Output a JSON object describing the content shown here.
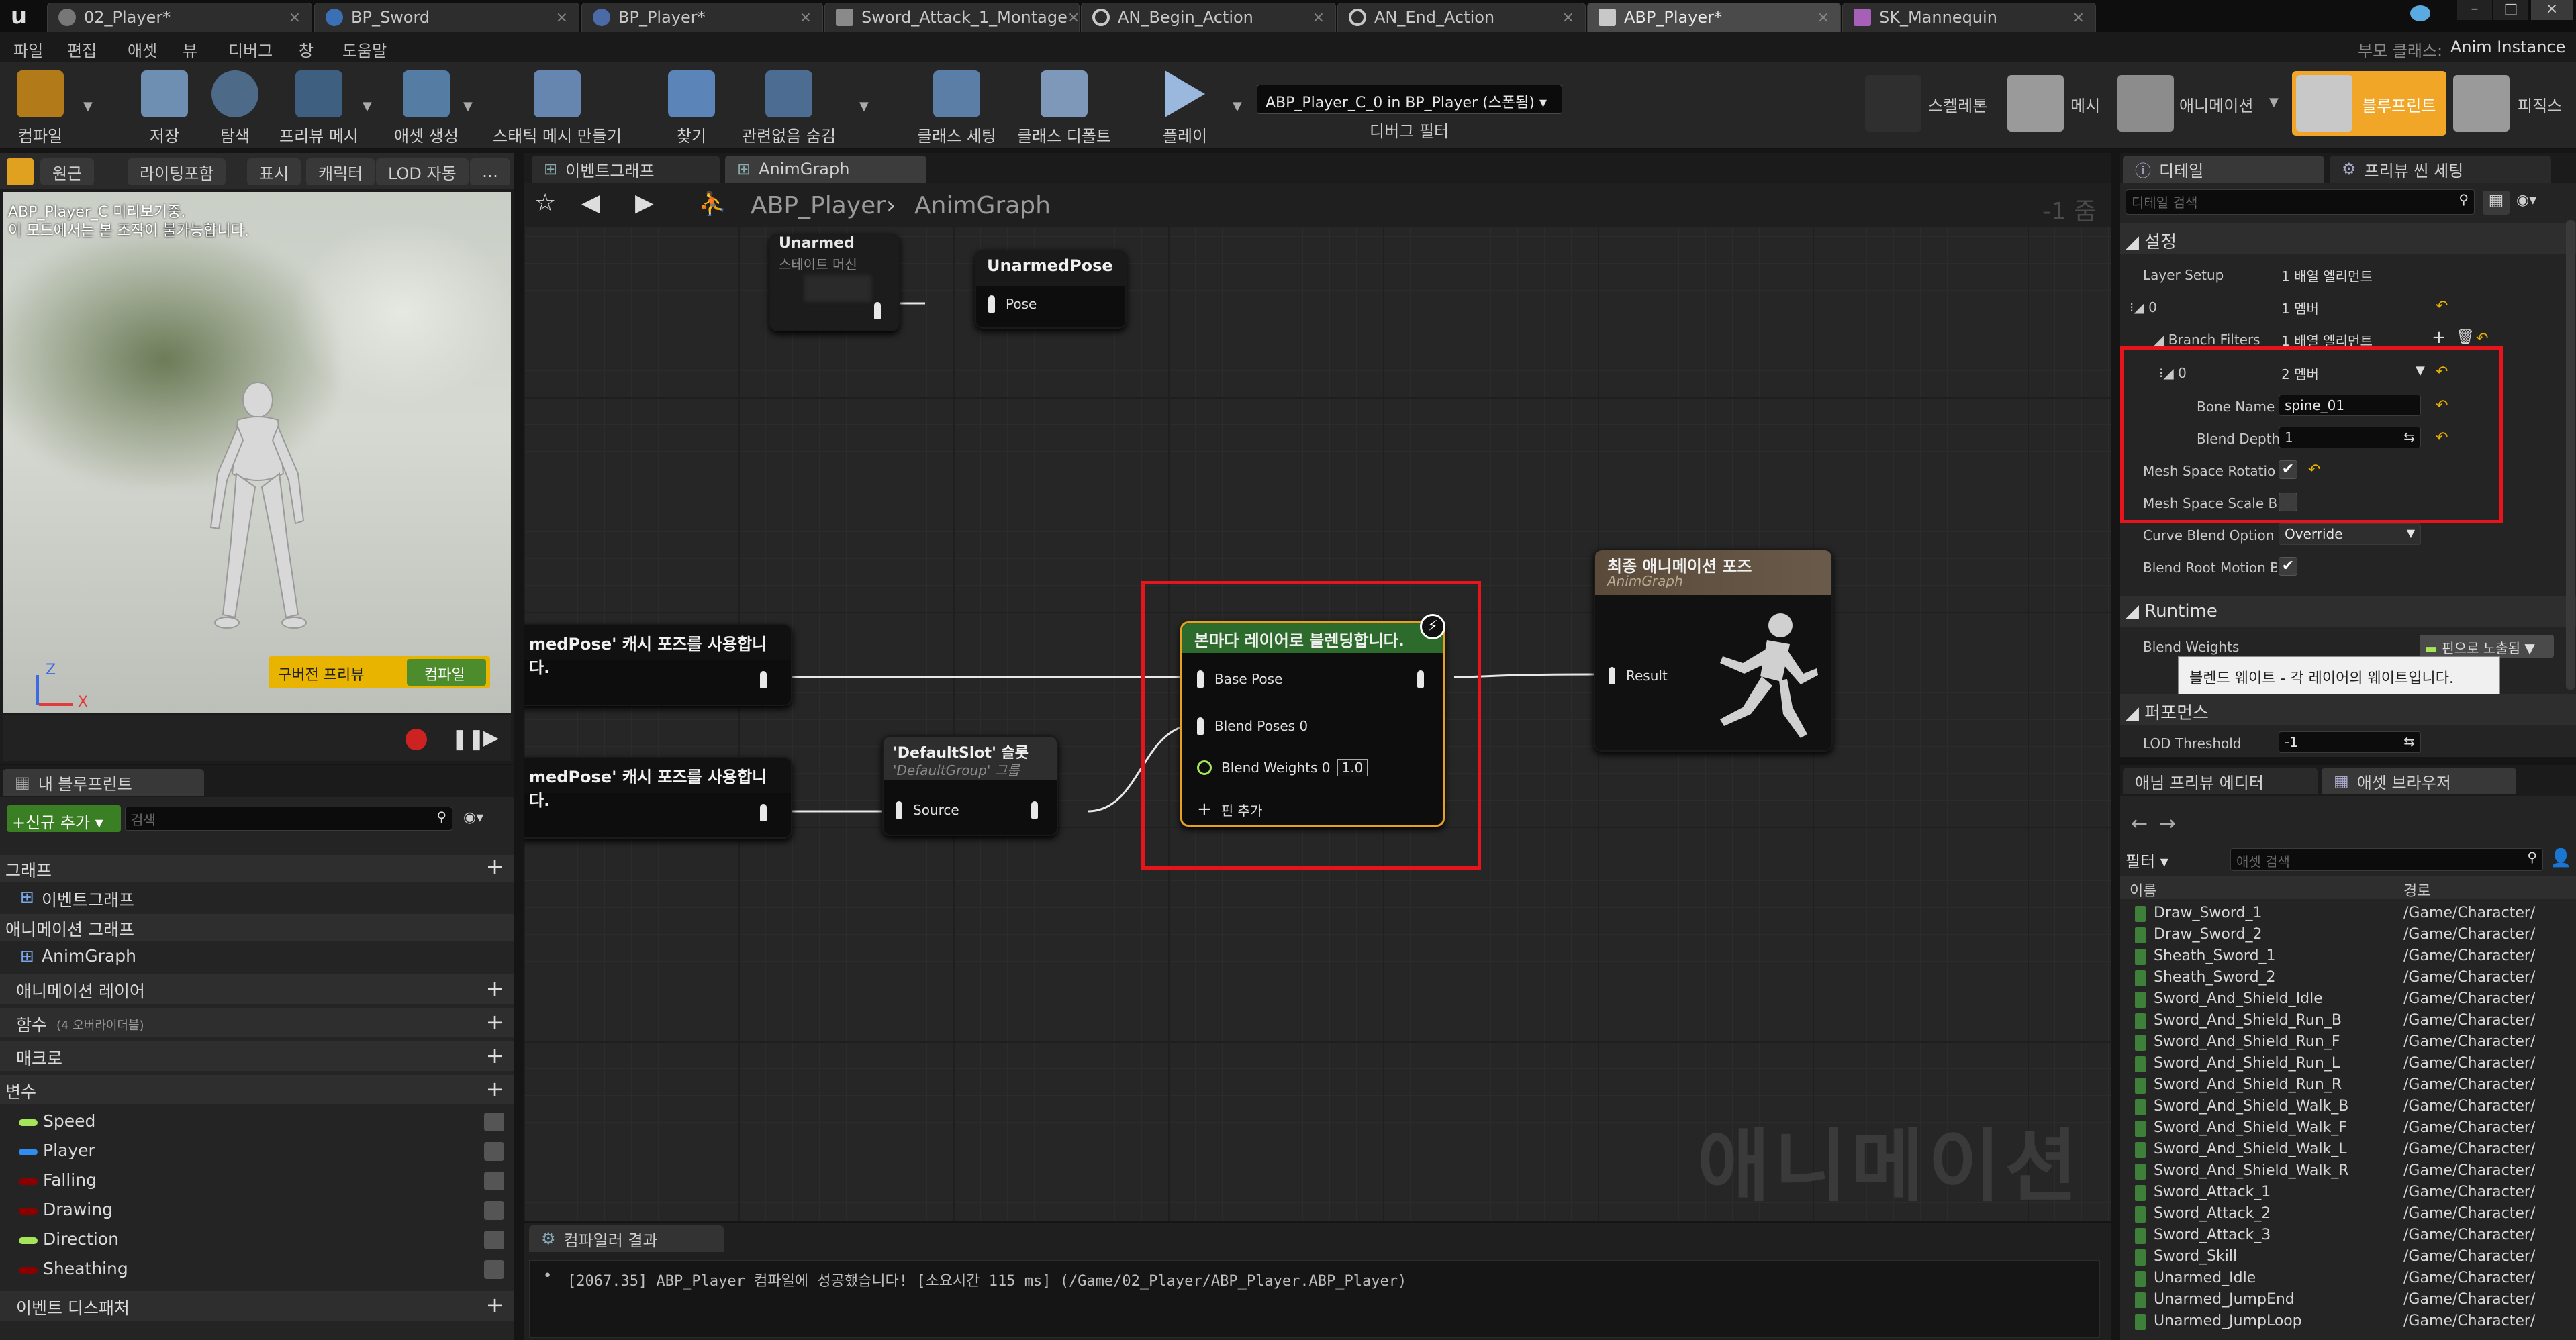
{
  "tabs": [
    {
      "label": "02_Player*"
    },
    {
      "label": "BP_Sword"
    },
    {
      "label": "BP_Player*"
    },
    {
      "label": "Sword_Attack_1_Montage"
    },
    {
      "label": "AN_Begin_Action"
    },
    {
      "label": "AN_End_Action"
    },
    {
      "label": "ABP_Player*"
    },
    {
      "label": "SK_Mannequin"
    }
  ],
  "menu": [
    "파일",
    "편집",
    "애셋",
    "뷰",
    "디버그",
    "창",
    "도움말"
  ],
  "top_right": {
    "parent_class_label": "부모 클래스:",
    "parent_class": "Anim Instance"
  },
  "toolbar": {
    "buttons": [
      "컴파일",
      "저장",
      "탐색",
      "프리뷰 메시",
      "애셋 생성",
      "스태틱 메시 만들기",
      "찾기",
      "관련없음 숨김",
      "클래스 세팅",
      "클래스 디폴트",
      "플레이"
    ],
    "debug_select": "ABP_Player_C_0 in BP_Player (스폰됨)",
    "debug_filter": "디버그 필터",
    "modes": [
      "스켈레톤",
      "메시",
      "애니메이션",
      "블루프린트",
      "피직스"
    ]
  },
  "viewport": {
    "chips": [
      "원근",
      "라이팅포함",
      "표시",
      "캐릭터",
      "LOD 자동"
    ],
    "line1": "ABP_Player_C 미리보기중.",
    "line2": "이 모드에서는 본 조작이 불가능합니다.",
    "stale_preview": "구버전 프리뷰",
    "compile": "컴파일",
    "axis_z": "Z",
    "axis_x": "X"
  },
  "my_blueprint": {
    "title": "내 블루프린트",
    "add_new": "신규 추가",
    "search_placeholder": "검색",
    "graphs": "그래프",
    "event_graph": "이벤트그래프",
    "anim_graphs": "애니메이션 그래프",
    "anim_graph": "AnimGraph",
    "anim_layers": "애니메이션 레이어",
    "functions": "함수",
    "functions_sub": "(4 오버라이더블)",
    "macros": "매크로",
    "variables": "변수",
    "vars": [
      {
        "name": "Speed",
        "color": "#a6e55a"
      },
      {
        "name": "Player",
        "color": "#2f8cf0"
      },
      {
        "name": "Falling",
        "color": "#8a0000"
      },
      {
        "name": "Drawing",
        "color": "#8a0000"
      },
      {
        "name": "Direction",
        "color": "#a6e55a"
      },
      {
        "name": "Sheathing",
        "color": "#8a0000"
      }
    ],
    "event_dispatchers": "이벤트 디스패처"
  },
  "graph": {
    "tab1": "이벤트그래프",
    "tab2": "AnimGraph",
    "crumb1": "ABP_Player",
    "crumb2": "AnimGraph",
    "zoom": "-1 줌",
    "watermark": "애니메이션",
    "nodes": {
      "unarmed_title": "Unarmed",
      "unarmed_sub": "스테이트 머신",
      "unarmed_pose_title": "UnarmedPose",
      "pose_pin": "Pose",
      "cache1": "medPose' 캐시 포즈를 사용합니다.",
      "cache2": "medPose' 캐시 포즈를 사용합니다.",
      "slot_title": "'DefaultSlot' 슬롯",
      "slot_sub": "'DefaultGroup' 그룹",
      "source": "Source",
      "blend_title": "본마다 레이어로 블렌딩합니다.",
      "base_pose": "Base Pose",
      "blend_poses": "Blend Poses 0",
      "blend_weights": "Blend Weights 0",
      "blend_weights_value": "1.0",
      "add_pin": "핀 추가",
      "final_title": "최종 애니메이션 포즈",
      "final_sub": "AnimGraph",
      "result": "Result"
    }
  },
  "compiler": {
    "tab": "컴파일러 결과",
    "message": "[2067.35] ABP_Player 컴파일에 성공했습니다! [소요시간 115 ms] (/Game/02_Player/ABP_Player.ABP_Player)"
  },
  "details": {
    "tab": "디테일",
    "tab2": "프리뷰 씬 세팅",
    "search_placeholder": "디테일 검색",
    "section_settings": "설정",
    "layer_setup": "Layer Setup",
    "layer_setup_val": "1 배열 엘리먼트",
    "idx0": "0",
    "idx0_val": "1 멤버",
    "branch_filters": "Branch Filters",
    "branch_filters_val": "1 배열 엘리먼트",
    "sub0": "0",
    "sub0_val": "2 멤버",
    "bone_name": "Bone Name",
    "bone_name_val": "spine_01",
    "blend_depth": "Blend Depth",
    "blend_depth_val": "1",
    "mesh_rot": "Mesh Space Rotatio",
    "mesh_scale": "Mesh Space Scale B",
    "curve_blend": "Curve Blend Option",
    "curve_blend_val": "Override",
    "blend_root": "Blend Root Motion B",
    "section_runtime": "Runtime",
    "blend_weights": "Blend Weights",
    "pin_exposed": "핀으로 노출됨",
    "tooltip": "블렌드 웨이트 - 각 레이어의 웨이트입니다.",
    "section_perf": "퍼포먼스",
    "lod": "LOD Threshold",
    "lod_val": "-1"
  },
  "assets": {
    "tab1": "애님 프리뷰 에디터",
    "tab2": "애셋 브라우저",
    "filter": "필터",
    "search_placeholder": "애셋 검색",
    "col_name": "이름",
    "col_path": "경로",
    "items": [
      {
        "name": "Draw_Sword_1",
        "path": "/Game/Character/"
      },
      {
        "name": "Draw_Sword_2",
        "path": "/Game/Character/"
      },
      {
        "name": "Sheath_Sword_1",
        "path": "/Game/Character/"
      },
      {
        "name": "Sheath_Sword_2",
        "path": "/Game/Character/"
      },
      {
        "name": "Sword_And_Shield_Idle",
        "path": "/Game/Character/"
      },
      {
        "name": "Sword_And_Shield_Run_B",
        "path": "/Game/Character/"
      },
      {
        "name": "Sword_And_Shield_Run_F",
        "path": "/Game/Character/"
      },
      {
        "name": "Sword_And_Shield_Run_L",
        "path": "/Game/Character/"
      },
      {
        "name": "Sword_And_Shield_Run_R",
        "path": "/Game/Character/"
      },
      {
        "name": "Sword_And_Shield_Walk_B",
        "path": "/Game/Character/"
      },
      {
        "name": "Sword_And_Shield_Walk_F",
        "path": "/Game/Character/"
      },
      {
        "name": "Sword_And_Shield_Walk_L",
        "path": "/Game/Character/"
      },
      {
        "name": "Sword_And_Shield_Walk_R",
        "path": "/Game/Character/"
      },
      {
        "name": "Sword_Attack_1",
        "path": "/Game/Character/"
      },
      {
        "name": "Sword_Attack_2",
        "path": "/Game/Character/"
      },
      {
        "name": "Sword_Attack_3",
        "path": "/Game/Character/"
      },
      {
        "name": "Sword_Skill",
        "path": "/Game/Character/"
      },
      {
        "name": "Unarmed_Idle",
        "path": "/Game/Character/"
      },
      {
        "name": "Unarmed_JumpEnd",
        "path": "/Game/Character/"
      },
      {
        "name": "Unarmed_JumpLoop",
        "path": "/Game/Character/"
      }
    ]
  }
}
